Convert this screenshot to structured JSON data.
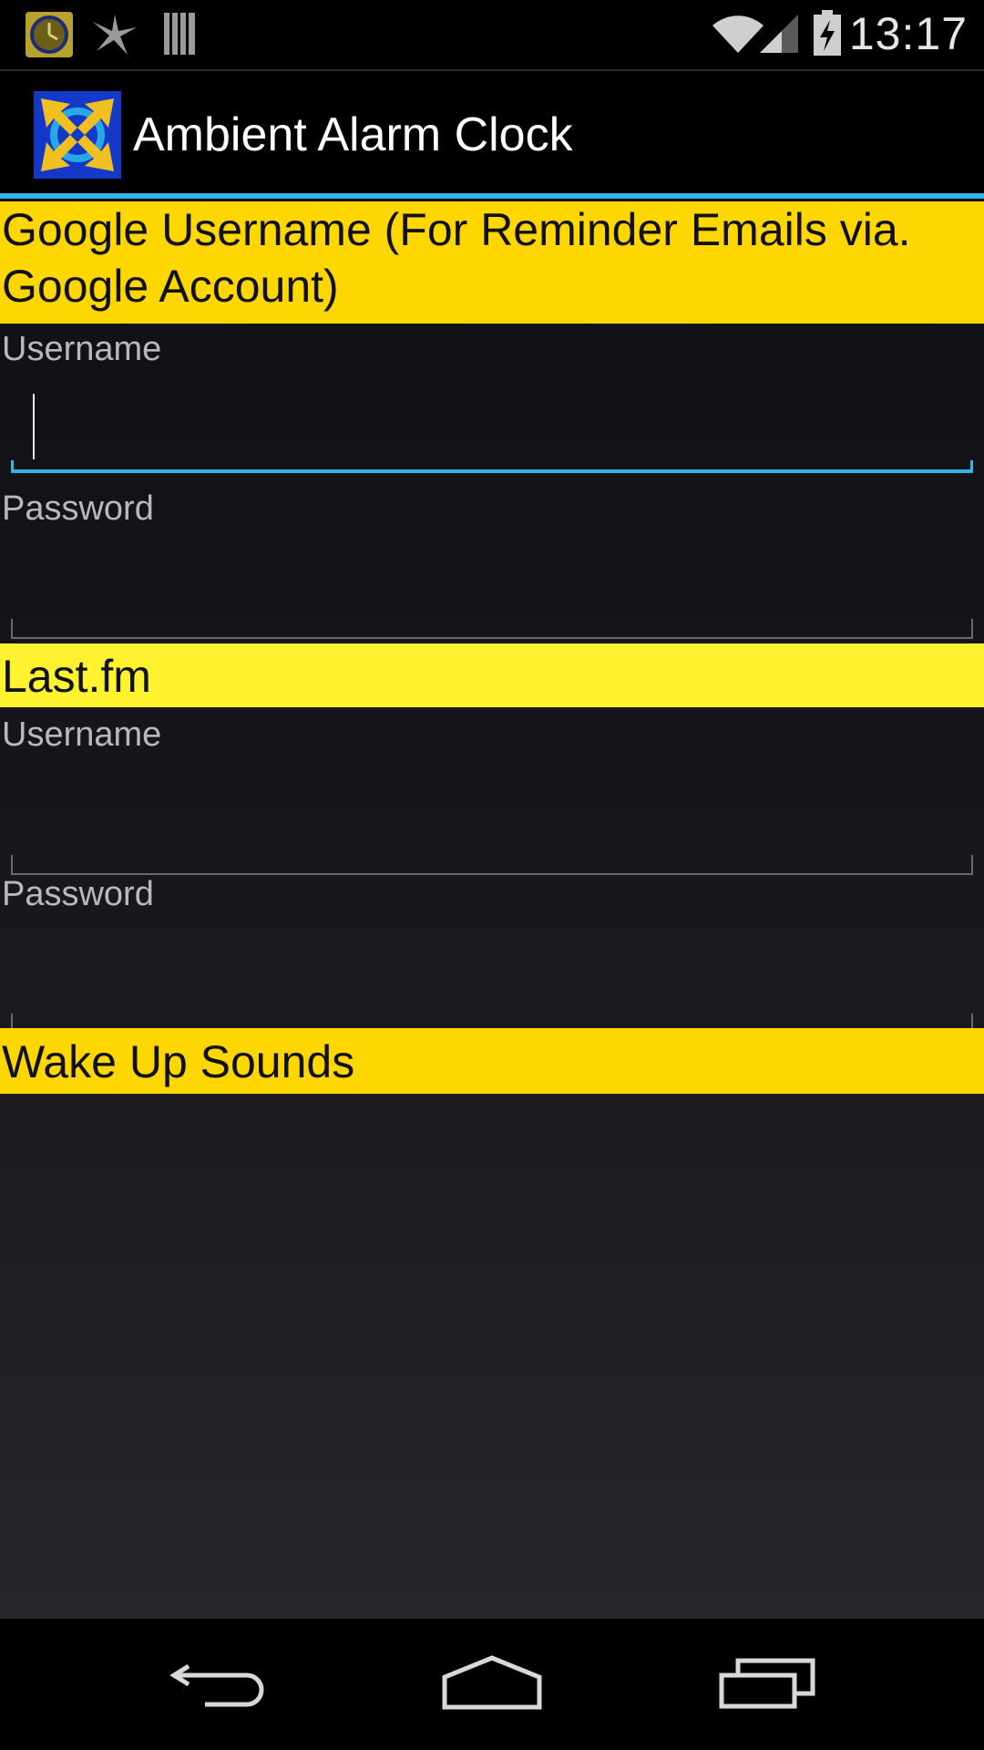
{
  "status_bar": {
    "time": "13:17",
    "notification_icons": [
      "alarm-clock-app-icon",
      "ninja-star-icon",
      "barcode-bars-icon"
    ],
    "system_icons": [
      "wifi-icon",
      "cell-signal-icon",
      "battery-charging-icon"
    ]
  },
  "action_bar": {
    "title": "Ambient Alarm Clock",
    "icon": "app-logo-icon"
  },
  "sections": {
    "google": {
      "header": "Google Username (For Reminder Emails via. Google Account)",
      "color": "#ffd700",
      "username_label": "Username",
      "username_value": "",
      "password_label": "Password",
      "password_value": ""
    },
    "lastfm": {
      "header": "Last.fm",
      "color": "#fff22e",
      "username_label": "Username",
      "username_value": "",
      "password_label": "Password",
      "password_value": ""
    },
    "wake_up": {
      "header": "Wake Up Sounds",
      "color": "#ffd700"
    }
  },
  "nav_bar": {
    "back": "back-icon",
    "home": "home-icon",
    "recents": "recent-apps-icon"
  },
  "colors": {
    "accent": "#33b5e5",
    "header_yellow": "#ffd700",
    "background": "#000000"
  }
}
